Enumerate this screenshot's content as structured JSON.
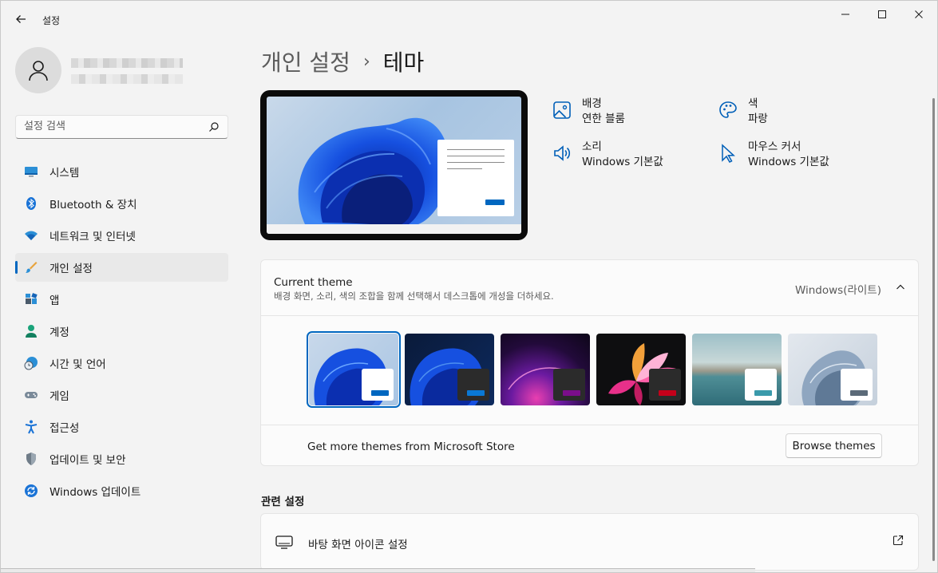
{
  "window": {
    "title": "설정",
    "controls": [
      "minimize",
      "maximize",
      "close"
    ]
  },
  "sidebar": {
    "search_placeholder": "설정 검색",
    "items": [
      {
        "label": "시스템",
        "icon": "monitor-icon"
      },
      {
        "label": "Bluetooth & 장치",
        "icon": "bluetooth-icon"
      },
      {
        "label": "네트워크 및 인터넷",
        "icon": "wifi-icon"
      },
      {
        "label": "개인 설정",
        "icon": "brush-icon",
        "active": true
      },
      {
        "label": "앱",
        "icon": "apps-icon"
      },
      {
        "label": "계정",
        "icon": "person-icon"
      },
      {
        "label": "시간 및 언어",
        "icon": "clock-globe-icon"
      },
      {
        "label": "게임",
        "icon": "gamepad-icon"
      },
      {
        "label": "접근성",
        "icon": "accessibility-icon"
      },
      {
        "label": "업데이트 및 보안",
        "icon": "shield-icon"
      },
      {
        "label": "Windows 업데이트",
        "icon": "refresh-icon"
      }
    ]
  },
  "breadcrumb": {
    "parent": "개인 설정",
    "separator": "›",
    "current": "테마"
  },
  "theme_properties": [
    {
      "title": "배경",
      "value": "연한 블룸",
      "icon": "image-icon"
    },
    {
      "title": "색",
      "value": "파랑",
      "icon": "palette-icon"
    },
    {
      "title": "소리",
      "value": "Windows 기본값",
      "icon": "speaker-icon"
    },
    {
      "title": "마우스 커서",
      "value": "Windows 기본값",
      "icon": "cursor-icon"
    }
  ],
  "current_theme": {
    "title": "Current theme",
    "description": "배경 화면, 소리, 색의 조합을 함께 선택해서 데스크톱에 개성을 더하세요.",
    "value": "Windows(라이트)",
    "themes": [
      {
        "name": "windows-light",
        "selected": true,
        "accent": "#0067c0",
        "card": "#ffffff"
      },
      {
        "name": "windows-dark",
        "selected": false,
        "accent": "#0a78d4",
        "card": "#2b2b2b"
      },
      {
        "name": "glow",
        "selected": false,
        "accent": "#7a0e8a",
        "card": "#2b2b2b"
      },
      {
        "name": "captured-motion",
        "selected": false,
        "accent": "#c4001a",
        "card": "#2b2b2b"
      },
      {
        "name": "sunrise",
        "selected": false,
        "accent": "#3a9aab",
        "card": "#ffffff"
      },
      {
        "name": "flow",
        "selected": false,
        "accent": "#5b6a78",
        "card": "#ffffff"
      }
    ],
    "store_text": "Get more themes from Microsoft Store",
    "browse_label": "Browse themes"
  },
  "related": {
    "section_title": "관련 설정",
    "items": [
      {
        "label": "바탕 화면 아이콘 설정",
        "icon": "desktop-icon"
      }
    ]
  }
}
